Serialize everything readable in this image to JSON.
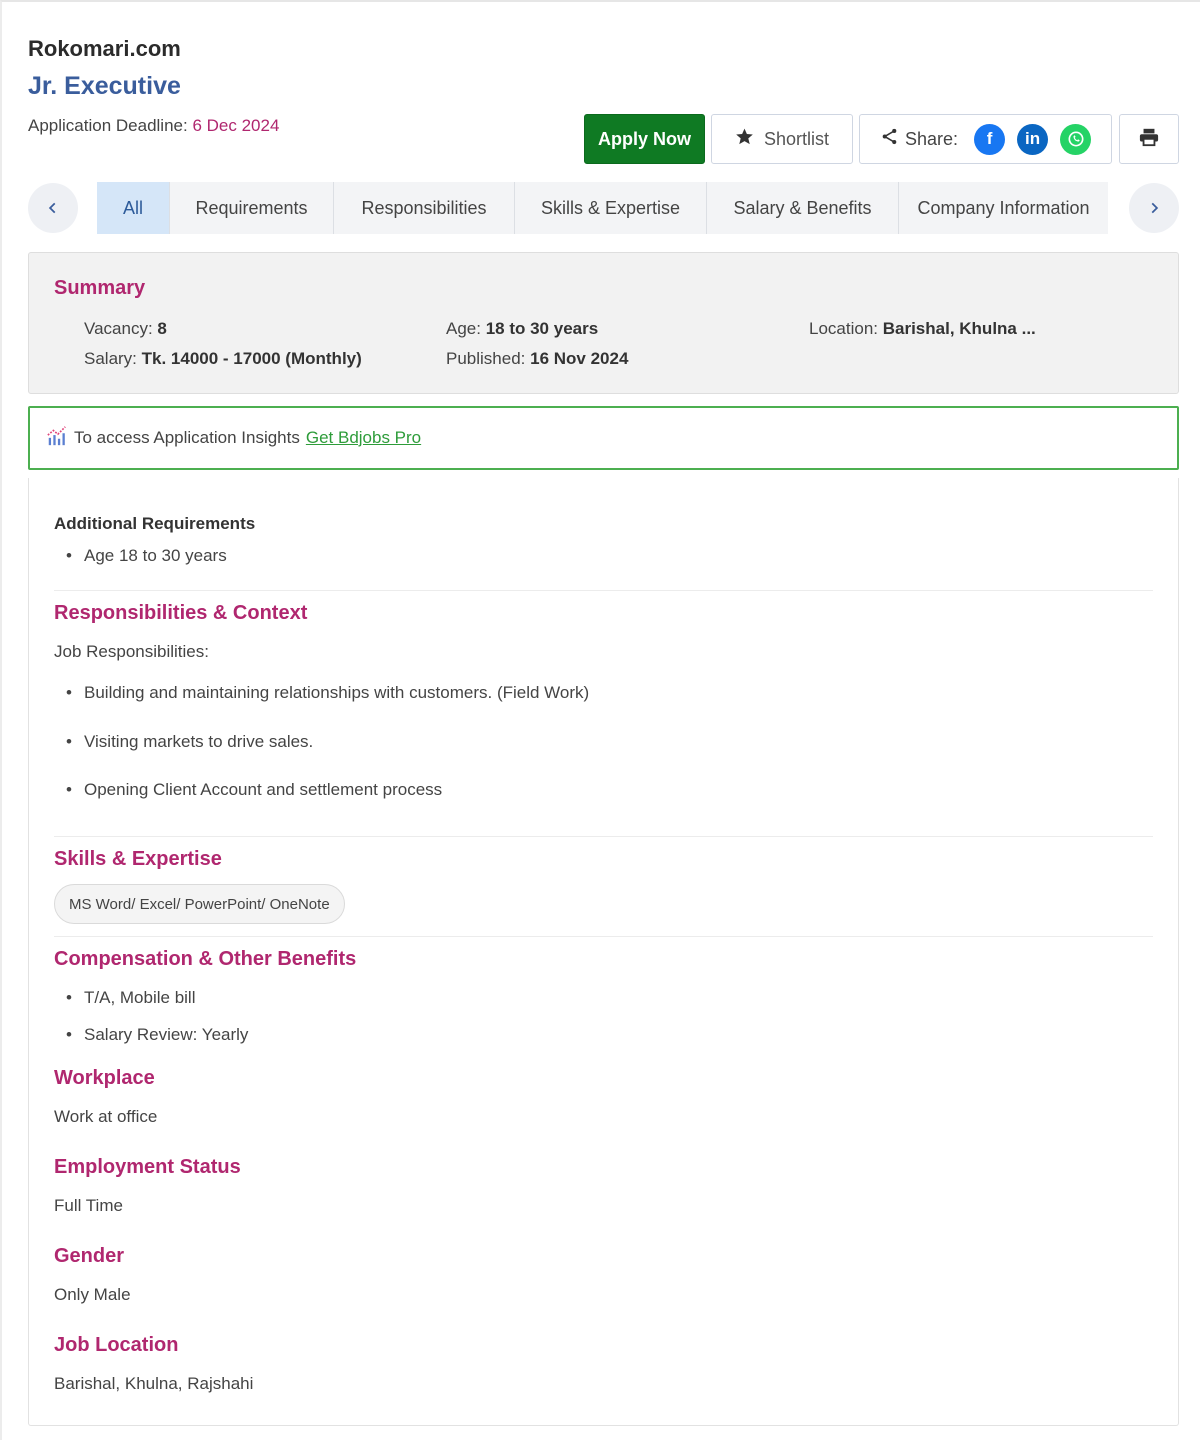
{
  "header": {
    "company": "Rokomari.com",
    "job_title": "Jr. Executive",
    "deadline_label": "Application Deadline: ",
    "deadline_date": "6 Dec 2024"
  },
  "actions": {
    "apply_label": "Apply Now",
    "shortlist_label": "Shortlist",
    "share_label": "Share:",
    "print_icon": "printer-icon"
  },
  "tabs": [
    {
      "label": "All",
      "active": true
    },
    {
      "label": "Requirements"
    },
    {
      "label": "Responsibilities"
    },
    {
      "label": "Skills & Expertise"
    },
    {
      "label": "Salary & Benefits"
    },
    {
      "label": "Company Information"
    }
  ],
  "summary": {
    "title": "Summary",
    "vacancy_label": "Vacancy: ",
    "vacancy": "8",
    "age_label": "Age: ",
    "age": "18 to 30 years",
    "location_label": "Location: ",
    "location": "Barishal, Khulna ...",
    "salary_label": "Salary: ",
    "salary": "Tk. 14000 - 17000 (Monthly)",
    "published_label": "Published: ",
    "published": "16 Nov 2024"
  },
  "insight": {
    "text": "To access Application Insights ",
    "link": "Get Bdjobs Pro"
  },
  "additional": {
    "title": "Additional Requirements",
    "items": [
      "Age 18 to 30 years"
    ]
  },
  "responsibilities": {
    "title": "Responsibilities & Context",
    "subtitle": "Job Responsibilities:",
    "items": [
      "Building and maintaining relationships with customers. (Field Work)",
      "Visiting markets to drive sales.",
      "Opening Client Account and settlement process"
    ]
  },
  "skills": {
    "title": "Skills & Expertise",
    "chips": [
      "MS Word/ Excel/ PowerPoint/ OneNote"
    ]
  },
  "compensation": {
    "title": "Compensation & Other Benefits",
    "items": [
      "T/A, Mobile bill",
      "Salary Review: Yearly"
    ]
  },
  "workplace": {
    "title": "Workplace",
    "value": "Work at office"
  },
  "employment": {
    "title": "Employment Status",
    "value": "Full Time"
  },
  "gender": {
    "title": "Gender",
    "value": "Only Male"
  },
  "job_location": {
    "title": "Job Location",
    "value": "Barishal, Khulna, Rajshahi"
  },
  "colors": {
    "accent_magenta": "#b0276f",
    "title_blue": "#3a5d9c",
    "apply_green": "#0f7a23",
    "insight_green": "#4caf50"
  }
}
